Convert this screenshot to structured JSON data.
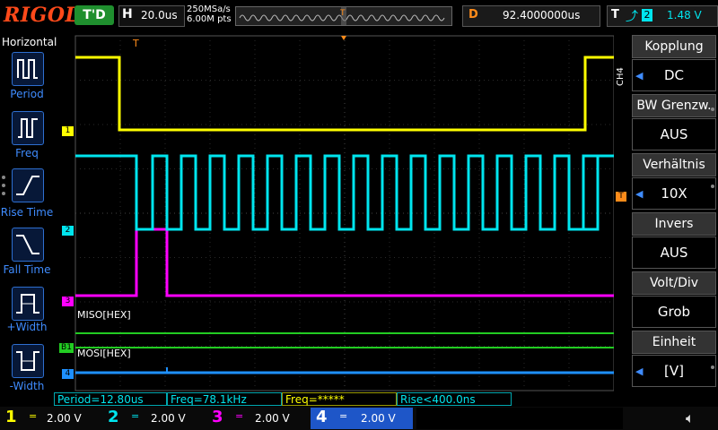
{
  "header": {
    "logo": "RIGOL",
    "trigger_status": "T'D",
    "horizontal_key": "H",
    "timebase": "20.0us",
    "sample_rate": "250MSa/s",
    "memory_depth": "6.00M pts",
    "delay_key": "D",
    "delay_value": "92.4000000us",
    "trigger_key": "T",
    "trigger_source": "2",
    "trigger_level": "1.48 V"
  },
  "left_menu": {
    "title": "Horizontal",
    "items": [
      {
        "label": "Period",
        "icon": "period-icon"
      },
      {
        "label": "Freq",
        "icon": "frequency-icon"
      },
      {
        "label": "Rise Time",
        "icon": "rise-time-icon"
      },
      {
        "label": "Fall Time",
        "icon": "fall-time-icon"
      },
      {
        "label": "+Width",
        "icon": "positive-width-icon"
      },
      {
        "label": "-Width",
        "icon": "negative-width-icon"
      }
    ]
  },
  "channel_menu": {
    "channel_tag": "CH4",
    "items": [
      {
        "title": "Kopplung",
        "value": "DC"
      },
      {
        "title": "BW Grenzw.",
        "value": "AUS"
      },
      {
        "title": "Verhältnis",
        "value": "10X"
      },
      {
        "title": "Invers",
        "value": "AUS"
      },
      {
        "title": "Volt/Div",
        "value": "Grob"
      },
      {
        "title": "Einheit",
        "value": "[V]"
      }
    ]
  },
  "waveform": {
    "markers": [
      "1",
      "2",
      "3",
      "B1",
      "4"
    ],
    "bus_labels": {
      "miso": "MISO[HEX]",
      "mosi": "MOSI[HEX]"
    },
    "trigger_marker": "T"
  },
  "measurements": {
    "period": "Period=12.80us",
    "freq": "Freq=78.1kHz",
    "freq2": "Freq=*****",
    "rise": "Rise<400.0ns"
  },
  "channels": [
    {
      "num": "1",
      "coupling": "=",
      "scale": "2.00 V",
      "color": "#ffff00"
    },
    {
      "num": "2",
      "coupling": "=",
      "scale": "2.00 V",
      "color": "#00e5ee"
    },
    {
      "num": "3",
      "coupling": "=",
      "scale": "2.00 V",
      "color": "#ff00ff"
    },
    {
      "num": "4",
      "coupling": "=",
      "scale": "2.00 V",
      "color": "#1e90ff"
    }
  ],
  "colors": {
    "ch1": "#ffff00",
    "ch2": "#00e5ee",
    "ch3": "#ff00ff",
    "ch4": "#1e90ff",
    "bus": "#22cc22",
    "accent": "#3f8cff",
    "trigger": "#ff8c1a"
  }
}
